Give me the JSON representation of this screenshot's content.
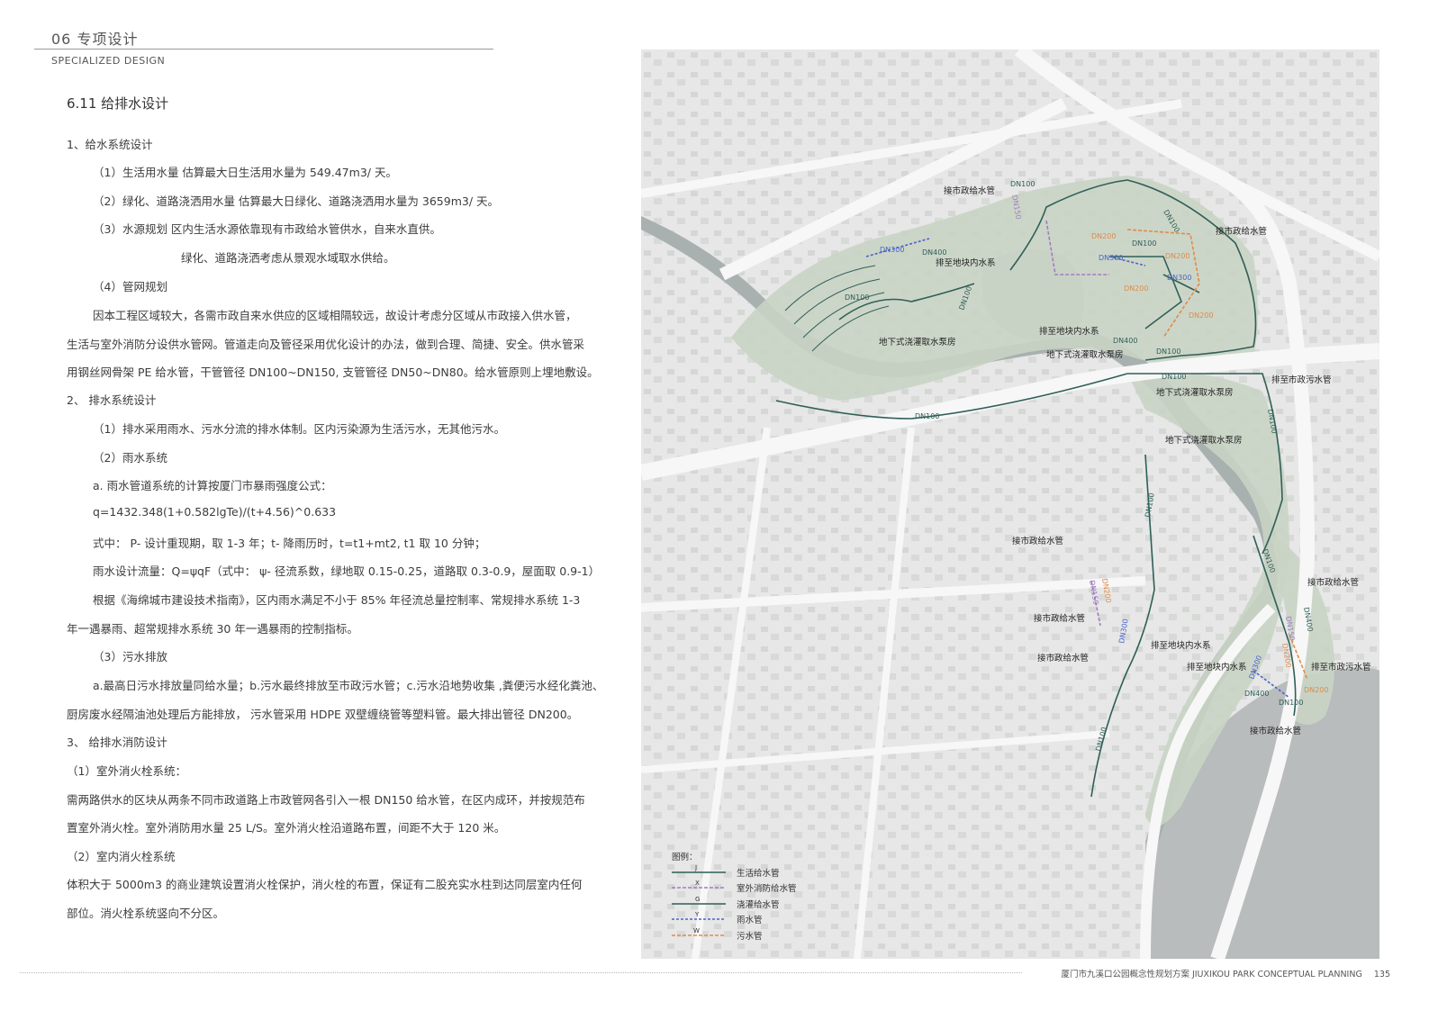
{
  "header": {
    "section_num": "06 专项设计",
    "section_en": "SPECIALIZED DESIGN"
  },
  "title": "6.11 给排水设计",
  "body": [
    "1、给水系统设计",
    "（1）生活用水量   估算最大日生活用水量为 549.47m3/ 天。",
    "（2）绿化、道路浇洒用水量   估算最大日绿化、道路浇洒用水量为 3659m3/ 天。",
    "（3）水源规划   区内生活水源依靠现有市政给水管供水，自来水直供。",
    "绿化、道路浇洒考虑从景观水域取水供给。",
    "（4）管网规划",
    "因本工程区域较大，各需市政自来水供应的区域相隔较远，故设计考虑分区域从市政接入供水管，",
    "生活与室外消防分设供水管网。管道走向及管径采用优化设计的办法，做到合理、简捷、安全。供水管采",
    "用钢丝网骨架 PE 给水管，干管管径 DN100~DN150, 支管管径 DN50~DN80。给水管原则上埋地敷设。",
    "2、 排水系统设计",
    "（1）排水采用雨水、污水分流的排水体制。区内污染源为生活污水，无其他污水。",
    "（2）雨水系统",
    "a. 雨水管道系统的计算按厦门市暴雨强度公式：",
    "q=1432.348(1+0.582lgTe)/(t+4.56)^0.633",
    "式中： P- 设计重现期，取 1-3 年；t- 降雨历时，t=t1+mt2, t1 取 10 分钟；",
    "雨水设计流量：Q=ψqF（式中： ψ- 径流系数，绿地取 0.15-0.25，道路取 0.3-0.9，屋面取 0.9-1）",
    "根据《海绵城市建设技术指南》，区内雨水满足不小于 85% 年径流总量控制率、常规排水系统 1-3",
    "年一遇暴雨、超常规排水系统 30 年一遇暴雨的控制指标。",
    "（3）污水排放",
    "a.最高日污水排放量同给水量；b.污水最终排放至市政污水管；c.污水沿地势收集 ,粪便污水经化粪池、",
    "厨房废水经隔油池处理后方能排放， 污水管采用 HDPE 双壁缠绕管等塑料管。最大排出管径 DN200。",
    "3、 给排水消防设计",
    "（1）室外消火栓系统：",
    "需两路供水的区块从两条不同市政道路上市政管网各引入一根 DN150 给水管，在区内成环，并按规范布",
    "置室外消火栓。室外消防用水量 25 L/S。室外消火栓沿道路布置，间距不大于 120 米。",
    "（2）室内消火栓系统",
    "体积大于 5000m3 的商业建筑设置消火栓保护，消火栓的布置，保证有二股充实水柱到达同层室内任何",
    "部位。消火栓系统竖向不分区。"
  ],
  "map": {
    "labels": [
      "接市政给水管",
      "接市政给水管",
      "排至地块内水系",
      "排至地块内水系",
      "地下式浇灌取水泵房",
      "地下式浇灌取水泵房",
      "排至市政污水管",
      "地下式浇灌取水泵房",
      "地下式浇灌取水泵房",
      "接市政给水管",
      "接市政给水管",
      "接市政给水管",
      "接市政给水管",
      "排至地块内水系",
      "排至地块内水系",
      "排至市政污水管",
      "接市政给水管"
    ],
    "pipe_labels": [
      "DN100",
      "DN150",
      "DN300",
      "DN400",
      "DN100",
      "DN100",
      "DN100",
      "DN200",
      "DN100",
      "DN300",
      "DN200",
      "DN200",
      "DN300",
      "DN200",
      "DN400",
      "DN100",
      "DN100",
      "DN100",
      "DN100",
      "DN100",
      "DN150",
      "DN200",
      "DN300",
      "DN100",
      "DN400",
      "DN150",
      "DN200",
      "DN300",
      "DN400",
      "DN100",
      "DN200",
      "DN100"
    ],
    "legend": {
      "title": "图例：",
      "items": [
        {
          "name": "生活给水管",
          "code": "J",
          "color": "#2f5f58"
        },
        {
          "name": "室外消防给水管",
          "code": "X",
          "color": "#a27cc0"
        },
        {
          "name": "浇灌给水管",
          "code": "G",
          "color": "#2f5f58"
        },
        {
          "name": "雨水管",
          "code": "Y",
          "color": "#4a64c8"
        },
        {
          "name": "污水管",
          "code": "W",
          "color": "#e08a4a"
        }
      ]
    }
  },
  "footer": {
    "text": "厦门市九溪口公园概念性规划方案 JIUXIKOU PARK CONCEPTUAL PLANNING",
    "page": "135"
  }
}
